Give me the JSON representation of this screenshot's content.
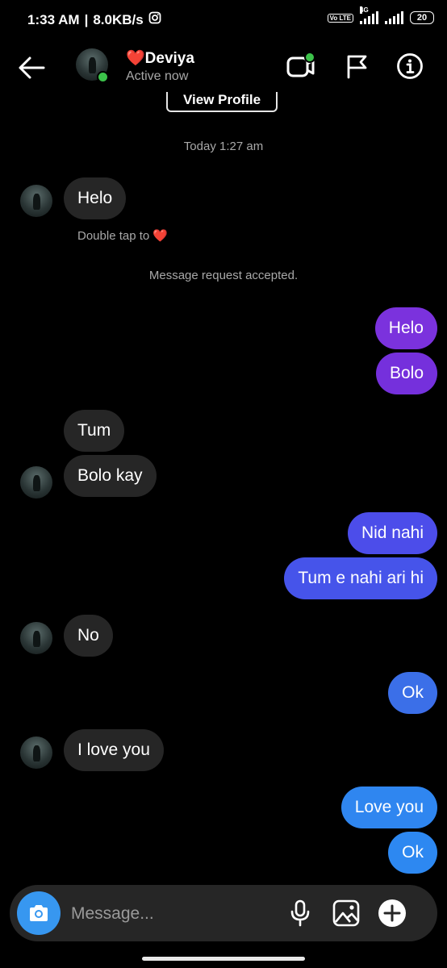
{
  "status_bar": {
    "time": "1:33 AM",
    "separator": "|",
    "speed": "8.0KB/s",
    "volte": "Vo LTE",
    "network": "4G",
    "battery": "20"
  },
  "header": {
    "name": "❤️Deviya",
    "status": "Active now"
  },
  "chat": {
    "view_profile": "View Profile",
    "timestamp": "Today 1:27 am",
    "hint": "Double tap to ❤️",
    "system_note": "Message request accepted.",
    "messages": [
      {
        "from": "them",
        "text": "Helo"
      },
      {
        "from": "me",
        "text": "Helo"
      },
      {
        "from": "me",
        "text": "Bolo"
      },
      {
        "from": "them",
        "text": "Tum"
      },
      {
        "from": "them",
        "text": "Bolo kay"
      },
      {
        "from": "me",
        "text": "Nid nahi"
      },
      {
        "from": "me",
        "text": "Tum e nahi ari hi"
      },
      {
        "from": "them",
        "text": "No"
      },
      {
        "from": "me",
        "text": "Ok"
      },
      {
        "from": "them",
        "text": "I love you"
      },
      {
        "from": "me",
        "text": "Love you"
      },
      {
        "from": "me",
        "text": "Ok"
      }
    ]
  },
  "composer": {
    "placeholder": "Message..."
  },
  "colors": {
    "background": "#000000",
    "incoming_bubble": "#262626",
    "outgoing_purple": "#7b32dd",
    "outgoing_indigo": "#4c4dea",
    "outgoing_blue": "#3b6fe8",
    "outgoing_light_blue": "#2f86f0",
    "accent_blue": "#3797f0",
    "online_green": "#3cc24a"
  },
  "icons": [
    "instagram-icon",
    "back-arrow-icon",
    "video-call-icon",
    "flag-icon",
    "info-icon",
    "camera-icon",
    "microphone-icon",
    "gallery-icon",
    "add-icon"
  ]
}
